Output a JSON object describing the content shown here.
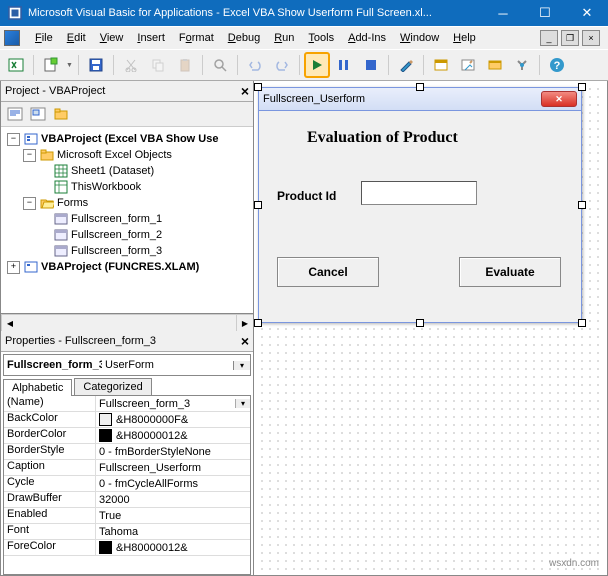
{
  "title": "Microsoft Visual Basic for Applications - Excel VBA Show Userform Full Screen.xl...",
  "menus": [
    "File",
    "Edit",
    "View",
    "Insert",
    "Format",
    "Debug",
    "Run",
    "Tools",
    "Add-Ins",
    "Window",
    "Help"
  ],
  "project": {
    "pane_title": "Project - VBAProject",
    "root": "VBAProject (Excel VBA Show Use",
    "g1": "Microsoft Excel Objects",
    "i1": "Sheet1 (Dataset)",
    "i2": "ThisWorkbook",
    "g2": "Forms",
    "f1": "Fullscreen_form_1",
    "f2": "Fullscreen_form_2",
    "f3": "Fullscreen_form_3",
    "root2": "VBAProject (FUNCRES.XLAM)"
  },
  "props": {
    "pane_title": "Properties - Fullscreen_form_3",
    "obj_name": "Fullscreen_form_3",
    "obj_type": "UserForm",
    "tab1": "Alphabetic",
    "tab2": "Categorized",
    "rows": {
      "Name_k": "(Name)",
      "Name_v": "Fullscreen_form_3",
      "BackColor_k": "BackColor",
      "BackColor_v": "&H8000000F&",
      "BorderColor_k": "BorderColor",
      "BorderColor_v": "&H80000012&",
      "BorderStyle_k": "BorderStyle",
      "BorderStyle_v": "0 - fmBorderStyleNone",
      "Caption_k": "Caption",
      "Caption_v": "Fullscreen_Userform",
      "Cycle_k": "Cycle",
      "Cycle_v": "0 - fmCycleAllForms",
      "DrawBuffer_k": "DrawBuffer",
      "DrawBuffer_v": "32000",
      "Enabled_k": "Enabled",
      "Enabled_v": "True",
      "Font_k": "Font",
      "Font_v": "Tahoma",
      "ForeColor_k": "ForeColor",
      "ForeColor_v": "&H80000012&"
    }
  },
  "form": {
    "caption": "Fullscreen_Userform",
    "heading": "Evaluation of Product",
    "label": "Product Id",
    "cancel": "Cancel",
    "evaluate": "Evaluate"
  },
  "credit": "wsxdn.com"
}
